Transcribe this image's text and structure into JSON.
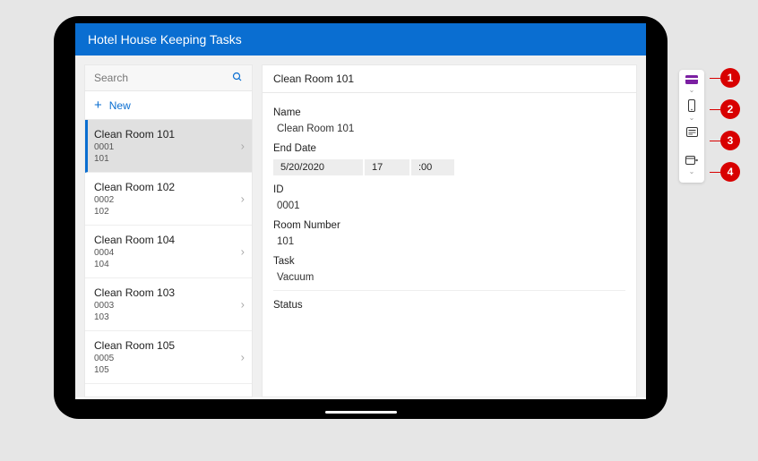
{
  "header": {
    "title": "Hotel House Keeping Tasks"
  },
  "search": {
    "placeholder": "Search"
  },
  "actions": {
    "new_label": "New"
  },
  "list": {
    "items": [
      {
        "title": "Clean Room 101",
        "id": "0001",
        "room": "101",
        "selected": true
      },
      {
        "title": "Clean Room 102",
        "id": "0002",
        "room": "102",
        "selected": false
      },
      {
        "title": "Clean Room 104",
        "id": "0004",
        "room": "104",
        "selected": false
      },
      {
        "title": "Clean Room 103",
        "id": "0003",
        "room": "103",
        "selected": false
      },
      {
        "title": "Clean Room 105",
        "id": "0005",
        "room": "105",
        "selected": false
      }
    ]
  },
  "detail": {
    "heading": "Clean Room 101",
    "labels": {
      "name": "Name",
      "end_date": "End Date",
      "id": "ID",
      "room_number": "Room Number",
      "task": "Task",
      "status": "Status"
    },
    "values": {
      "name": "Clean Room 101",
      "end_date_date": "5/20/2020",
      "end_date_hour": "17",
      "end_date_min": ":00",
      "id": "0001",
      "room_number": "101",
      "task": "Vacuum",
      "status": ""
    }
  },
  "toolbar": {
    "items": [
      {
        "name": "card-icon"
      },
      {
        "name": "phone-icon"
      },
      {
        "name": "form-icon"
      },
      {
        "name": "calendar-icon"
      }
    ]
  },
  "callouts": [
    "1",
    "2",
    "3",
    "4"
  ]
}
